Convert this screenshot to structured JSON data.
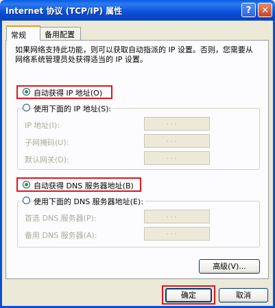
{
  "window": {
    "title": "Internet 协议 (TCP/IP) 属性",
    "help_label": "?",
    "close_label": "✕"
  },
  "tabs": [
    "常规",
    "备用配置"
  ],
  "description": "如果网络支持此功能，则可以获取自动指派的 IP 设置。否则，您需要从网络系统管理员处获得适当的 IP 设置。",
  "ip": {
    "auto_label": "自动获得 IP 地址(O)",
    "manual_label": "使用下面的 IP 地址(S):",
    "fields": [
      {
        "label": "IP 地址(I):",
        "value": ". . ."
      },
      {
        "label": "子网掩码(U):",
        "value": ". . ."
      },
      {
        "label": "默认网关(D):",
        "value": ". . ."
      }
    ]
  },
  "dns": {
    "auto_label": "自动获得 DNS 服务器地址(B)",
    "manual_label": "使用下面的 DNS 服务器地址(E):",
    "fields": [
      {
        "label": "首选 DNS 服务器(P):",
        "value": ". . ."
      },
      {
        "label": "备用 DNS 服务器(A):",
        "value": ". . ."
      }
    ]
  },
  "buttons": {
    "advanced": "高级(V)...",
    "ok": "确定",
    "cancel": "取消"
  }
}
